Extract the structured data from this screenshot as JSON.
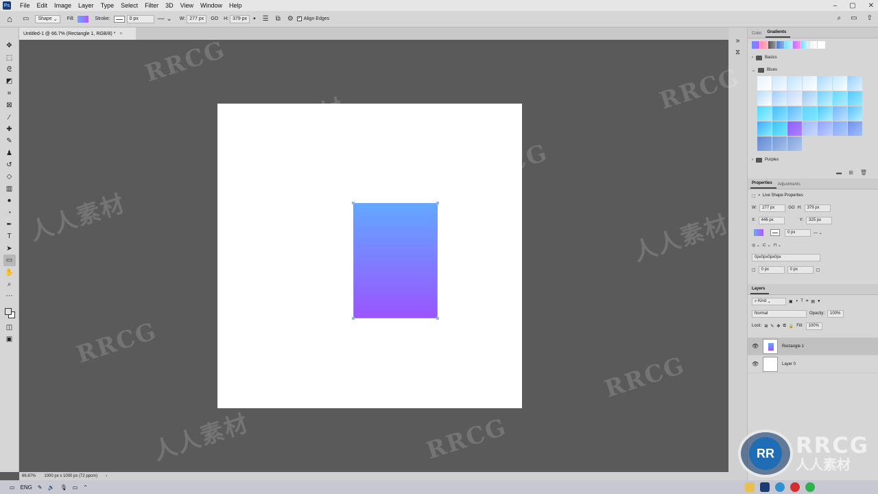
{
  "menubar": {
    "logo": "Ps",
    "items": [
      "File",
      "Edit",
      "Image",
      "Layer",
      "Type",
      "Select",
      "Filter",
      "3D",
      "View",
      "Window",
      "Help"
    ]
  },
  "options": {
    "mode": "Shape",
    "fill_label": "Fill:",
    "stroke_label": "Stroke:",
    "stroke_width": "0 px",
    "w_label": "W:",
    "w_value": "277 px",
    "link": "GO",
    "h_label": "H:",
    "h_value": "379 px",
    "align_edges": "Align Edges"
  },
  "doc": {
    "tab_title": "Untitled-1 @ 66.7% (Rectangle 1, RGB/8) *",
    "close": "×"
  },
  "status": {
    "zoom": "66.67%",
    "doc_info": "1000 px x 1000 px (72 ppcm)"
  },
  "colors": {
    "gradient_top": "#62a8ff",
    "gradient_bottom": "#9a55ff",
    "artboard": "#ffffff",
    "workspace": "#5a5a5a"
  },
  "gradients_panel": {
    "tabs": [
      "Color",
      "Gradients"
    ],
    "folders": [
      "Basics",
      "Blues",
      "Purples"
    ]
  },
  "properties_panel": {
    "tabs": [
      "Properties",
      "Adjustments"
    ],
    "title": "Live Shape Properties",
    "w_label": "W:",
    "w": "277 px",
    "link": "GO",
    "h_label": "H:",
    "h": "379 px",
    "x_label": "X:",
    "x": "446 px",
    "y_label": "Y:",
    "y": "325 px",
    "stroke": "0 px",
    "radii": "0px0px0px0px",
    "corner1": "0 px",
    "corner2": "0 px"
  },
  "layers_panel": {
    "title": "Layers",
    "kind": "Kind",
    "blend": "Normal",
    "opacity_label": "Opacity:",
    "opacity": "100%",
    "lock_label": "Lock:",
    "fill_label": "Fill:",
    "fill": "100%",
    "layers": [
      {
        "name": "Rectangle 1",
        "selected": true
      },
      {
        "name": "Layer 0",
        "selected": false
      }
    ]
  },
  "taskbar": {
    "lang": "ENG"
  },
  "watermark": {
    "text_latin": "RRCG",
    "text_cjk": "人人素材",
    "badge": "RR"
  }
}
